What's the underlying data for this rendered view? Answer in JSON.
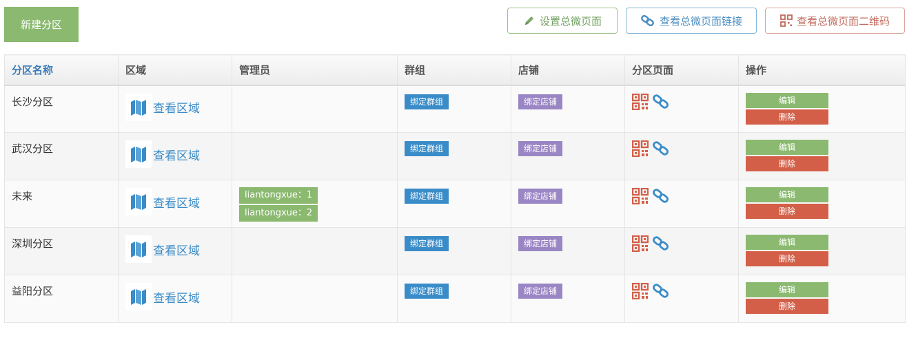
{
  "toolbar": {
    "new_label": "新建分区",
    "set_page_label": "设置总微页面",
    "view_link_label": "查看总微页面链接",
    "view_qr_label": "查看总微页面二维码"
  },
  "columns": [
    "分区名称",
    "区域",
    "管理员",
    "群组",
    "店铺",
    "分区页面",
    "操作"
  ],
  "labels": {
    "view_region": "查看区域",
    "bind_group": "绑定群组",
    "bind_store": "绑定店铺",
    "edit": "编辑",
    "delete": "删除"
  },
  "rows": [
    {
      "name": "长沙分区",
      "admins": []
    },
    {
      "name": "武汉分区",
      "admins": []
    },
    {
      "name": "未来",
      "admins": [
        "liantongxue：1",
        "liantongxue：2"
      ]
    },
    {
      "name": "深圳分区",
      "admins": []
    },
    {
      "name": "益阳分区",
      "admins": []
    }
  ],
  "colors": {
    "accent_green": "#8ab96f",
    "accent_blue": "#3a8cc8",
    "accent_purple": "#9a86c4",
    "accent_red": "#d35f48"
  },
  "icons": {
    "set_page": "pencil-icon",
    "view_link": "link-icon",
    "view_qr": "qrcode-icon",
    "region": "map-icon"
  }
}
